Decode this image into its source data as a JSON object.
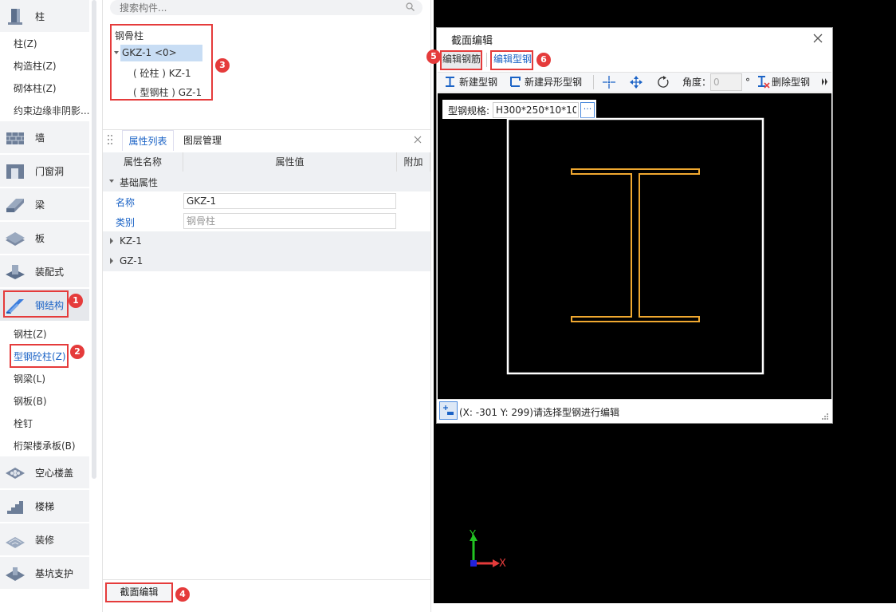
{
  "search": {
    "placeholder": "搜索构件..."
  },
  "sidebar": {
    "categories": [
      {
        "label": "柱",
        "icon": "column-icon"
      },
      {
        "label": "墙",
        "icon": "wall-icon"
      },
      {
        "label": "门窗洞",
        "icon": "door-window-icon"
      },
      {
        "label": "梁",
        "icon": "beam-icon"
      },
      {
        "label": "板",
        "icon": "slab-icon"
      },
      {
        "label": "装配式",
        "icon": "prefab-icon"
      },
      {
        "label": "钢结构",
        "icon": "steel-structure-icon"
      },
      {
        "label": "空心楼盖",
        "icon": "hollow-floor-icon"
      },
      {
        "label": "楼梯",
        "icon": "stair-icon"
      },
      {
        "label": "装修",
        "icon": "decoration-icon"
      },
      {
        "label": "基坑支护",
        "icon": "pit-support-icon"
      }
    ],
    "column_items": [
      "柱(Z)",
      "构造柱(Z)",
      "砌体柱(Z)",
      "约束边缘非阴影..."
    ],
    "steel_items": [
      "钢柱(Z)",
      "型钢砼柱(Z)",
      "钢梁(L)",
      "钢板(B)",
      "栓钉",
      "桁架楼承板(B)"
    ]
  },
  "tree": {
    "root": "钢骨柱",
    "selected": "GKZ-1 <0>",
    "children": [
      "( 砼柱 ) KZ-1",
      "( 型钢柱 ) GZ-1"
    ]
  },
  "props": {
    "tabs": [
      "属性列表",
      "图层管理"
    ],
    "columns": [
      "属性名称",
      "属性值",
      "附加"
    ],
    "group": "基础属性",
    "rows": [
      {
        "name": "名称",
        "value": "GKZ-1"
      },
      {
        "name": "类别",
        "value": "钢骨柱"
      }
    ],
    "collapsed": [
      "KZ-1",
      "GZ-1"
    ]
  },
  "bottom_button": "截面编辑",
  "dialog": {
    "title": "截面编辑",
    "tabs": [
      "编辑钢筋",
      "编辑型钢"
    ],
    "toolbar": {
      "new_steel": "新建型钢",
      "new_irregular": "新建异形型钢",
      "angle_label": "角度：",
      "angle_value": "0",
      "angle_unit": "°",
      "delete_steel": "删除型钢"
    },
    "spec_label": "型钢规格:",
    "spec_value": "H300*250*10*10",
    "spec_btn": "···",
    "status": "(X: -301 Y: 299)请选择型钢进行编辑"
  },
  "axes": {
    "x": "X",
    "y": "Y"
  },
  "badges": [
    "1",
    "2",
    "3",
    "4",
    "5",
    "6"
  ],
  "colors": {
    "accent": "#1b63c6",
    "highlight": "#e53b3b",
    "steel": "#f0a830"
  }
}
